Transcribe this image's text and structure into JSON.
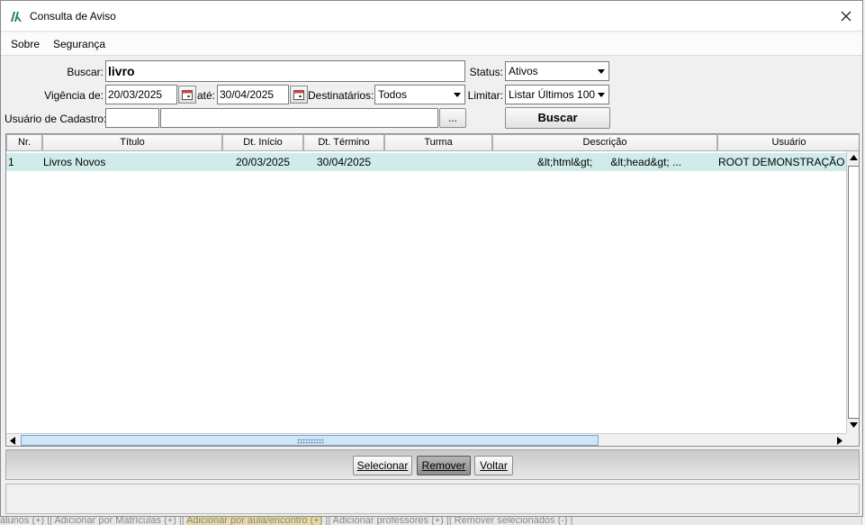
{
  "window": {
    "title": "Consulta de Aviso"
  },
  "menu": {
    "sobre": "Sobre",
    "seguranca": "Segurança"
  },
  "form": {
    "buscar_label": "Buscar:",
    "buscar_value": "livro",
    "status_label": "Status:",
    "status_value": "Ativos",
    "vigencia_label": "Vigência de:",
    "vigencia_de": "20/03/2025",
    "ate_label": "até:",
    "vigencia_ate": "30/04/2025",
    "destinatarios_label": "Destinatários:",
    "destinatarios_value": "Todos",
    "limitar_label": "Limitar:",
    "limitar_value": "Listar Últimos 100",
    "usuario_label": "Usuário de Cadastro:",
    "usuario_code": "",
    "usuario_name": "",
    "lookup_button": "...",
    "buscar_button": "Buscar"
  },
  "table": {
    "columns": [
      "Nr.",
      "Título",
      "Dt. Início",
      "Dt. Término",
      "Turma",
      "Descrição",
      "Usuário"
    ],
    "rows": [
      {
        "nr": "1",
        "titulo": "Livros Novos",
        "dt_inicio": "20/03/2025",
        "dt_termino": "30/04/2025",
        "turma": "",
        "descricao": "&lt;html&gt;      &lt;head&gt; ...",
        "usuario": "ROOT DEMONSTRAÇÃO JA"
      }
    ]
  },
  "buttons": {
    "selecionar": "Selecionar",
    "remover": "Remover",
    "voltar": "Voltar"
  },
  "background": {
    "strip_a": "alunos (+) || Adicionar por Matrículas (+) || ",
    "strip_b": "Adicionar por aula/encontro (+)",
    "strip_c": " || Adicionar professores (+) || Remover selecionados (-) |"
  },
  "colors": {
    "selected_row": "#cfeceb",
    "accent": "#1f7f6e"
  }
}
